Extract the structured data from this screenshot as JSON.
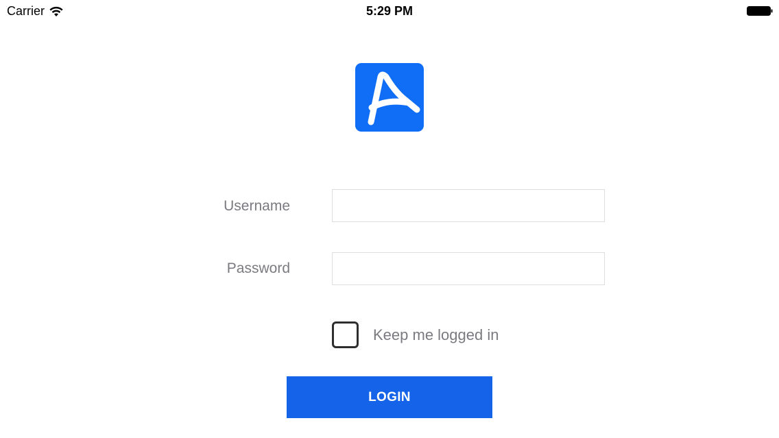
{
  "status_bar": {
    "carrier": "Carrier",
    "time": "5:29 PM",
    "icons": [
      "wifi-icon",
      "battery-icon"
    ]
  },
  "logo": {
    "icon": "letter-a-logo",
    "color": "#0f6ef5"
  },
  "form": {
    "username": {
      "label": "Username",
      "value": "",
      "placeholder": ""
    },
    "password": {
      "label": "Password",
      "value": "",
      "placeholder": ""
    },
    "keep_logged_in": {
      "label": "Keep me logged in",
      "checked": false
    },
    "login_button": {
      "label": "LOGIN",
      "color": "#1463e8"
    }
  }
}
